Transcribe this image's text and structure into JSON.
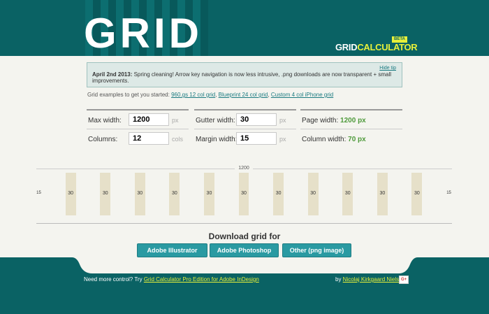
{
  "header": {
    "logo_text": "GRID",
    "brand_word1": "GRID",
    "brand_word2": "CALCULATOR",
    "badge": "BETA"
  },
  "notice": {
    "date": "April 2nd 2013:",
    "text": " Spring cleaning! Arrow key navigation is now less intrusive, .png downloads are now transparent + small improvements.",
    "hide_label": "Hide tip"
  },
  "examples": {
    "intro": "Grid examples to get you started: ",
    "links": [
      "960.gs 12 col grid",
      "Blueprint 24 col grid",
      "Custom 4 col iPhone grid"
    ]
  },
  "form": {
    "max_width": {
      "label": "Max width:",
      "value": "1200",
      "unit": "px"
    },
    "columns": {
      "label": "Columns:",
      "value": "12",
      "unit": "cols"
    },
    "gutter_width": {
      "label": "Gutter width:",
      "value": "30",
      "unit": "px"
    },
    "margin_width": {
      "label": "Margin width:",
      "value": "15",
      "unit": "px"
    },
    "page_width": {
      "label": "Page width: ",
      "value": "1200 px"
    },
    "column_width": {
      "label": "Column width: ",
      "value": "70 px"
    }
  },
  "preview": {
    "total_label": "1200",
    "margin": "15",
    "column": "70",
    "gutter": "30",
    "column_count": 12
  },
  "download": {
    "title": "Download grid for",
    "buttons": [
      "Adobe Illustrator",
      "Adobe Photoshop",
      "Other (png image)"
    ]
  },
  "footer": {
    "more_text": "Need more control? Try ",
    "pro_link": "Grid Calculator Pro Edition for Adobe InDesign",
    "by_text": "by ",
    "author": "Nicolaj Kirkgaard Nielsen",
    "gplus": "G+"
  },
  "colors": {
    "teal": "#0a6264",
    "accent_yellow": "#e7f03a",
    "button": "#2a9aa2",
    "column": "#c6bb8e",
    "gutter": "#e6e0c9",
    "result_green": "#4e9a3b"
  }
}
